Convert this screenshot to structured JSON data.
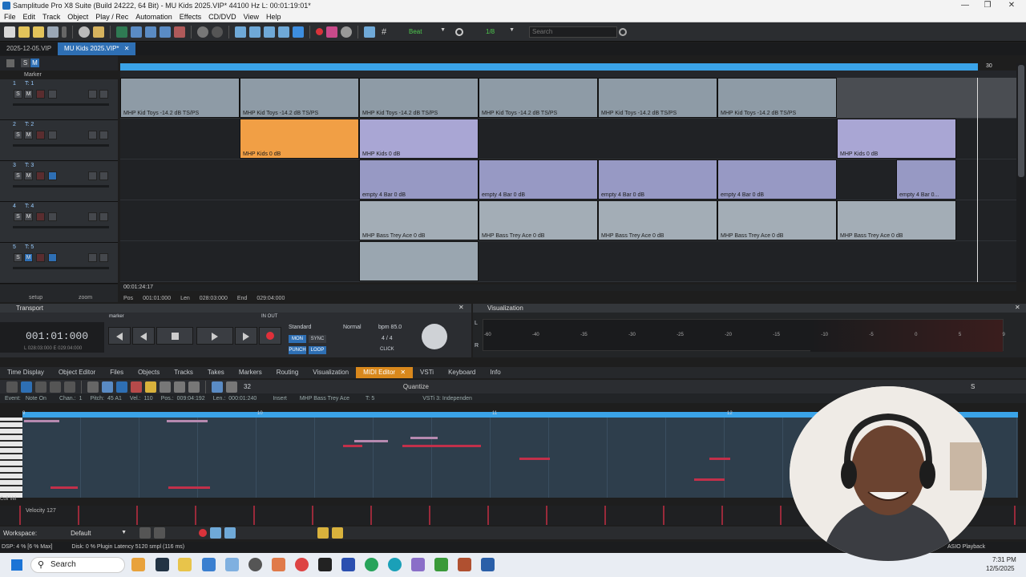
{
  "window": {
    "title": "Samplitude Pro X8 Suite (Build 24222, 64 Bit)  -  MU Kids 2025.VIP*  44100 Hz L: 00:01:19:01*"
  },
  "menu": [
    "File",
    "Edit",
    "Track",
    "Object",
    "Play / Rec",
    "Automation",
    "Effects",
    "CD/DVD",
    "View",
    "Help"
  ],
  "toolbar": {
    "snap_label": "Beat",
    "quantize_value": "1/8",
    "search_placeholder": "Search"
  },
  "doc_tabs": [
    {
      "label": "2025-12-05.VIP",
      "active": false
    },
    {
      "label": "MU Kids 2025.VIP*",
      "active": true
    }
  ],
  "marker_label": "Marker",
  "tracks": [
    {
      "num": "1",
      "name": "T: 1"
    },
    {
      "num": "2",
      "name": "T: 2"
    },
    {
      "num": "3",
      "name": "T: 3"
    },
    {
      "num": "4",
      "name": "T: 4"
    },
    {
      "num": "5",
      "name": "T: 5"
    }
  ],
  "track_buttons": {
    "solo": "S",
    "mute": "M"
  },
  "ruler_end": "30",
  "clips": {
    "t1": "MHP Kid Toys  -14.2 dB  TS/PS",
    "t2": "MHP Kids  0 dB",
    "t3": "empty 4 Bar  0 dB",
    "t3_short": "empty 4 Bar  0...",
    "t4": "MHP Bass Trey Ace  0 dB"
  },
  "time_tooltip": "00:01:24:17",
  "position": {
    "pos_label": "Pos",
    "pos": "001:01:000",
    "len_label": "Len",
    "len": "028:03:000",
    "end_label": "End",
    "end": "029:04:000"
  },
  "left_footer": {
    "setup": "setup",
    "zoom": "zoom"
  },
  "transport": {
    "header": "Transport",
    "time": "001:01:000",
    "sub_time": "L 028:03:000  E 029:04:000",
    "marker_label": "marker",
    "in_out": "IN  OUT",
    "mode": "Standard",
    "normal": "Normal",
    "bpm": "bpm  85.0",
    "sig": "4 / 4",
    "mon": "MON",
    "sync": "SYNC",
    "punch": "PUNCH",
    "loop": "LOOP",
    "click": "CLICK"
  },
  "visualization": {
    "header": "Visualization",
    "scale": [
      "-60",
      "-40",
      "-35",
      "-30",
      "-25",
      "-20",
      "-15",
      "-10",
      "-5",
      "0",
      "5",
      "9"
    ],
    "l": "L",
    "r": "R"
  },
  "lower_tabs": [
    {
      "label": "Time Display",
      "active": false
    },
    {
      "label": "Object Editor",
      "active": false
    },
    {
      "label": "Files",
      "active": false
    },
    {
      "label": "Objects",
      "active": false
    },
    {
      "label": "Tracks",
      "active": false
    },
    {
      "label": "Takes",
      "active": false
    },
    {
      "label": "Markers",
      "active": false
    },
    {
      "label": "Routing",
      "active": false
    },
    {
      "label": "Visualization",
      "active": false
    },
    {
      "label": "MIDI Editor",
      "active": true
    },
    {
      "label": "VSTi",
      "active": false
    },
    {
      "label": "Keyboard",
      "active": false
    },
    {
      "label": "Info",
      "active": false
    }
  ],
  "midi": {
    "grid": "32",
    "quantize": "Quantize",
    "event": "Event:",
    "event_value": "Note On",
    "chan_label": "Chan.:",
    "chan": "1",
    "pitch_label": "Pitch:",
    "pitch": "45 A1",
    "vel_label": "Vel.:",
    "vel": "110",
    "pos_label": "Pos.:",
    "pos": "009:04:192",
    "len_label": "Len.:",
    "len": "000:01:240",
    "insert": "Insert",
    "object": "MHP Bass Trey Ace",
    "track": "T: 5",
    "vsti": "VSTi 3: Independen",
    "velocity_label": "Velocity 127",
    "ruler_marks": [
      "9",
      "10",
      "11",
      "12"
    ],
    "col_label": "Coll Vel"
  },
  "workspace": {
    "label": "Workspace:",
    "value": "Default"
  },
  "status": {
    "dsp": "DSP: 4 %   [6 % Max]",
    "disk": "Disk:  0 %  Plugin Latency 5120 smpl (116 ms)",
    "asio": "ASIO Playback"
  },
  "taskbar": {
    "search": "Search",
    "time": "7:31 PM",
    "date": "12/5/2025"
  },
  "colors": {
    "accent": "#3aa3e8",
    "orange_clip": "#f19f45",
    "active_tab": "#d9881c",
    "note": "#c2304a"
  }
}
